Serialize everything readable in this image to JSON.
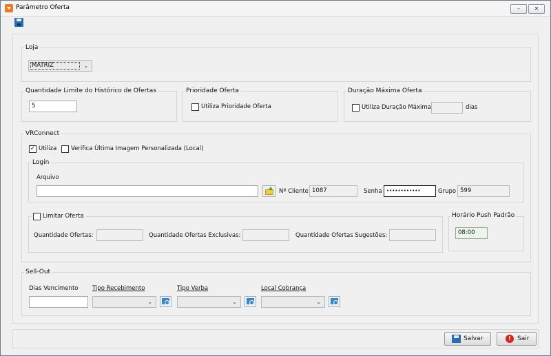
{
  "window": {
    "title": "Parâmetro Oferta",
    "controls": [
      "–",
      "✕"
    ]
  },
  "loja": {
    "title": "Loja",
    "selected": "MATRIZ"
  },
  "quantidade_limite": {
    "title": "Quantidade Limite do Histórico de Ofertas",
    "value": "5"
  },
  "prioridade": {
    "title": "Prioridade Oferta",
    "checkbox_label": "Utiliza Prioridade Oferta"
  },
  "duracao": {
    "title": "Duração Máxima Oferta",
    "checkbox_label": "Utiliza Duração Máxima",
    "value": "",
    "unit": "dias"
  },
  "vrconnect": {
    "title": "VRConnect",
    "utiliza_label": "Utiliza",
    "utiliza_checked": true,
    "verifica_label": "Verifica Última Imagem Personalizada (Local)",
    "login": {
      "title": "Login",
      "arquivo_label": "Arquivo",
      "arquivo_value": "",
      "cliente_label": "Nº Cliente",
      "cliente_value": "1087",
      "senha_label": "Senha",
      "senha_value": "••••••••••••",
      "grupo_label": "Grupo",
      "grupo_value": "599"
    },
    "limitar": {
      "label": "Limitar Oferta",
      "qtd_ofertas_label": "Quantidade Ofertas:",
      "qtd_exclusivas_label": "Quantidade Ofertas Exclusivas:",
      "qtd_sugestoes_label": "Quantidade Ofertas Sugestões:"
    },
    "horario": {
      "title": "Horário Push Padrão",
      "value": "08:00"
    }
  },
  "sellout": {
    "title": "Sell-Out",
    "dias_label": "Dias Vencimento",
    "tipo_recebimento_label": "Tipo Recebimento",
    "tipo_verba_label": "Tipo Verba",
    "local_cobranca_label": "Local Cobrança"
  },
  "footer": {
    "salvar_label": "Salvar",
    "sair_label": "Sair"
  },
  "colors": {
    "accent": "#f07a1f",
    "save_icon": "#2a6db5",
    "sair_icon": "#d7261e"
  }
}
